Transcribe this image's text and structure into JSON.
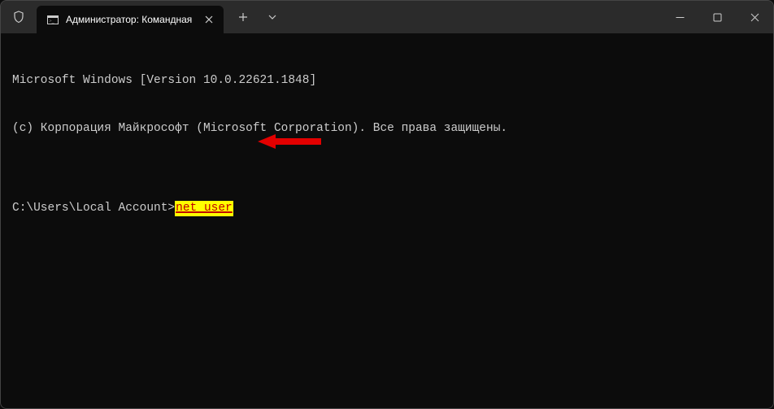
{
  "tab": {
    "title": "Администратор: Командная"
  },
  "terminal": {
    "line1": "Microsoft Windows [Version 10.0.22621.1848]",
    "line2": "(c) Корпорация Майкрософт (Microsoft Corporation). Все права защищены.",
    "blank": "",
    "prompt": "C:\\Users\\Local Account>",
    "command": "net user"
  }
}
